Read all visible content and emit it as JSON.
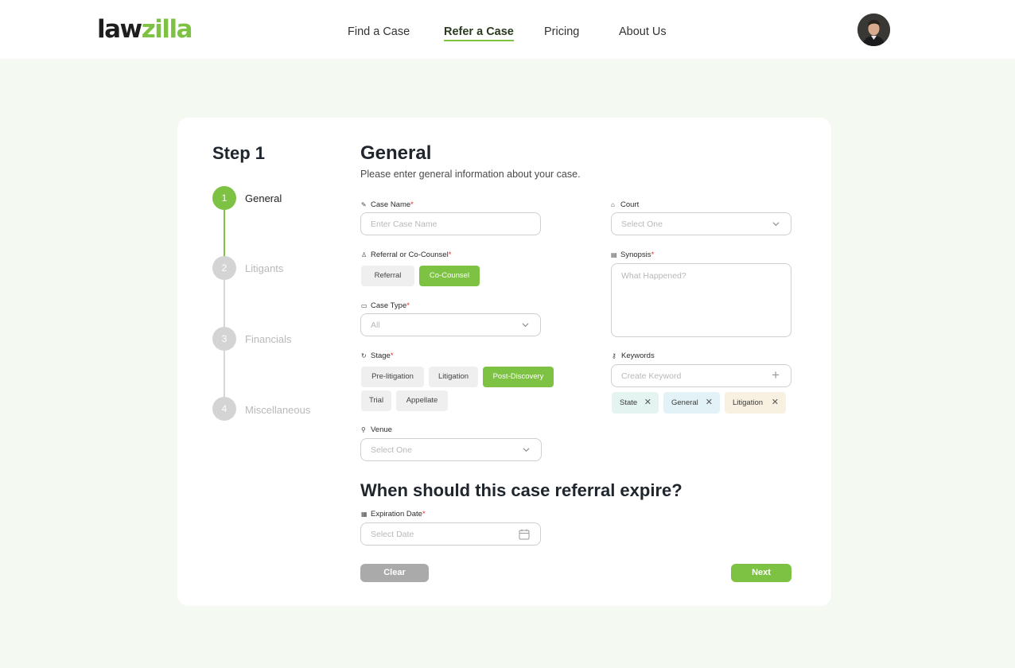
{
  "header": {
    "logo_part1": "law",
    "logo_part2": "zilla",
    "nav": [
      "Find a Case",
      "Refer a Case",
      "Pricing",
      "About Us"
    ],
    "active_nav": "Refer a Case"
  },
  "steps": {
    "title": "Step 1",
    "items": [
      {
        "num": "1",
        "label": "General",
        "active": true
      },
      {
        "num": "2",
        "label": "Litigants",
        "active": false
      },
      {
        "num": "3",
        "label": "Financials",
        "active": false
      },
      {
        "num": "4",
        "label": "Miscellaneous",
        "active": false
      }
    ]
  },
  "form": {
    "title": "General",
    "subtitle": "Please enter general information about your case.",
    "case_name": {
      "label": "Case Name",
      "placeholder": "Enter Case Name",
      "value": ""
    },
    "referral": {
      "label": "Referral or Co-Counsel",
      "options": [
        "Referral",
        "Co-Counsel"
      ],
      "selected": "Co-Counsel"
    },
    "case_type": {
      "label": "Case Type",
      "value": "All"
    },
    "stage": {
      "label": "Stage",
      "options": [
        "Pre-litigation",
        "Litigation",
        "Post-Discovery",
        "Trial",
        "Appellate"
      ],
      "selected": "Post-Discovery"
    },
    "venue": {
      "label": "Venue",
      "value": "Select One"
    },
    "court": {
      "label": "Court",
      "value": "Select One"
    },
    "synopsis": {
      "label": "Synopsis",
      "placeholder": "What Happened?",
      "value": ""
    },
    "keywords": {
      "label": "Keywords",
      "placeholder": "Create Keyword",
      "add_icon": "+",
      "tags": [
        "State",
        "General",
        "Litigation"
      ],
      "remove_icon": "✕"
    },
    "required_mark": "*"
  },
  "expiration": {
    "title": "When should this case referral expire?",
    "label": "Expiration Date",
    "placeholder": "Select Date"
  },
  "buttons": {
    "clear": "Clear",
    "next": "Next"
  },
  "colors": {
    "accent": "#7dc242",
    "background": "#f4f9f2",
    "clear_button": "#aaaaaa",
    "tag_state": "#e4f4f1",
    "tag_general": "#e3f2f6",
    "tag_litigation": "#f8f1e1"
  }
}
